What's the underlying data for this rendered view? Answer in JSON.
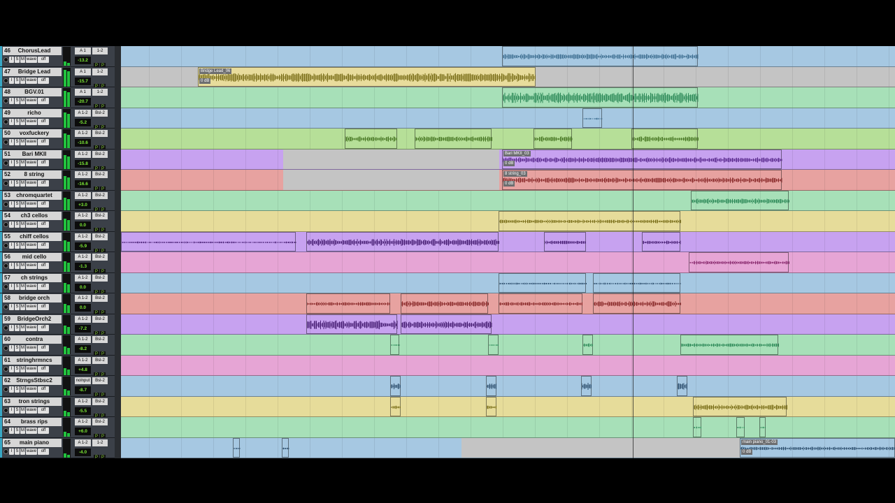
{
  "colors": {
    "blue": "#a6c8e2",
    "yellow": "#e6dc9a",
    "green": "#a7e0b8",
    "lime": "#b6df98",
    "purple": "#c7a2f0",
    "salmon": "#e7a2a0",
    "pink": "#e6a5d5",
    "gap": "#c4c4c4"
  },
  "tracks": [
    {
      "num": "46",
      "name": "ChorusLead",
      "io1": "A 1",
      "io2": "1-2",
      "vol": "-13.2",
      "color": "blue",
      "clips": [
        {
          "s": 545,
          "e": 825,
          "w": 3,
          "c": "#3f6f92"
        }
      ]
    },
    {
      "num": "47",
      "name": "Bridge Lead",
      "io1": "A 1",
      "io2": "1-2",
      "vol": "-15.7",
      "color": "gap",
      "clips": [
        {
          "s": 110,
          "e": 593,
          "w": 5,
          "c": "#7b6f1a",
          "bg": "#e8dc9c",
          "label": "Bridge Lead_06",
          "gain": "0 dB"
        }
      ]
    },
    {
      "num": "48",
      "name": "BGV.01",
      "io1": "A 1",
      "io2": "1-2",
      "vol": "-20.7",
      "color": "green",
      "clips": [
        {
          "s": 545,
          "e": 825,
          "w": 6,
          "c": "#2e8a59"
        }
      ]
    },
    {
      "num": "49",
      "name": "richo",
      "io1": "A 1-2",
      "io2": "Bsl-2",
      "vol": "-5.2",
      "color": "blue",
      "clips": [
        {
          "s": 660,
          "e": 688,
          "w": 1,
          "c": "#3f6f92"
        }
      ]
    },
    {
      "num": "50",
      "name": "voxfuckery",
      "io1": "A 1-2",
      "io2": "Bsl-2",
      "vol": "-10.6",
      "color": "lime",
      "clips": [
        {
          "s": 320,
          "e": 395,
          "w": 3,
          "c": "#4a7a26"
        },
        {
          "s": 420,
          "e": 530,
          "w": 3,
          "c": "#4a7a26"
        },
        {
          "s": 590,
          "e": 645,
          "w": 3,
          "c": "#4a7a26"
        },
        {
          "s": 730,
          "e": 825,
          "w": 3,
          "c": "#4a7a26"
        }
      ]
    },
    {
      "num": "51",
      "name": "Bari MKII",
      "io1": "A 1-2",
      "io2": "Bsl-2",
      "vol": "-15.8",
      "color": "purple",
      "gapS": 232,
      "gapE": 541,
      "clips": [
        {
          "s": 545,
          "e": 945,
          "w": 3,
          "c": "#5a2a8e",
          "label": "Bari MKII_03",
          "gain": "0 dB"
        }
      ]
    },
    {
      "num": "52",
      "name": "8 string",
      "io1": "A 1-2",
      "io2": "Bsl-2",
      "vol": "-16.6",
      "color": "salmon",
      "gapS": 232,
      "gapE": 541,
      "clips": [
        {
          "s": 545,
          "e": 945,
          "w": 3,
          "c": "#8a2a2a",
          "label": "8 string_03",
          "gain": "0 dB"
        }
      ]
    },
    {
      "num": "53",
      "name": "chromquartet",
      "io1": "A 1-2",
      "io2": "Bsl-2",
      "vol": "+3.0",
      "color": "green",
      "clips": [
        {
          "s": 815,
          "e": 955,
          "w": 3,
          "c": "#2e8a59"
        }
      ]
    },
    {
      "num": "54",
      "name": "ch3 cellos",
      "io1": "A 1-2",
      "io2": "Bsl-2",
      "vol": "0.0",
      "color": "yellow",
      "clips": [
        {
          "s": 540,
          "e": 800,
          "w": 2,
          "c": "#7b6f1a"
        }
      ]
    },
    {
      "num": "55",
      "name": "chiff cellos",
      "io1": "A 1-2",
      "io2": "Bsl-2",
      "vol": "-5.9",
      "color": "purple",
      "clips": [
        {
          "s": 0,
          "e": 250,
          "w": 1,
          "c": "#4a2076"
        },
        {
          "s": 265,
          "e": 540,
          "w": 4,
          "c": "#4a2076"
        },
        {
          "s": 605,
          "e": 665,
          "w": 2,
          "c": "#4a2076"
        },
        {
          "s": 745,
          "e": 800,
          "w": 2,
          "c": "#4a2076"
        }
      ]
    },
    {
      "num": "56",
      "name": "mid cello",
      "io1": "A 1-2",
      "io2": "Bsl-2",
      "vol": "-1.3",
      "color": "pink",
      "clips": [
        {
          "s": 812,
          "e": 955,
          "w": 2,
          "c": "#8a2a6e"
        }
      ]
    },
    {
      "num": "57",
      "name": "ch strings",
      "io1": "A 1-2",
      "io2": "Bsl-2",
      "vol": "0.0",
      "color": "blue",
      "clips": [
        {
          "s": 540,
          "e": 665,
          "w": 1,
          "c": "#2e4f6e"
        },
        {
          "s": 675,
          "e": 800,
          "w": 1,
          "c": "#2e4f6e"
        }
      ]
    },
    {
      "num": "58",
      "name": "bridge orch",
      "io1": "A 1-2",
      "io2": "Bsl-2",
      "vol": "0.0",
      "color": "salmon",
      "clips": [
        {
          "s": 265,
          "e": 385,
          "w": 2,
          "c": "#8a2a2a"
        },
        {
          "s": 400,
          "e": 525,
          "w": 3,
          "c": "#8a2a2a"
        },
        {
          "s": 540,
          "e": 660,
          "w": 2,
          "c": "#8a2a2a"
        },
        {
          "s": 675,
          "e": 800,
          "w": 3,
          "c": "#8a2a2a"
        }
      ]
    },
    {
      "num": "59",
      "name": "BridgeOrch2",
      "io1": "A 1-2",
      "io2": "Bsl-2",
      "vol": "-7.2",
      "color": "purple",
      "clips": [
        {
          "s": 265,
          "e": 395,
          "w": 5,
          "c": "#4a2076"
        },
        {
          "s": 400,
          "e": 530,
          "w": 4,
          "c": "#4a2076"
        }
      ]
    },
    {
      "num": "60",
      "name": "contra",
      "io1": "A 1-2",
      "io2": "Bsl-2",
      "vol": "-8.2",
      "color": "green",
      "clips": [
        {
          "s": 385,
          "e": 398,
          "w": 1,
          "c": "#2e8a59"
        },
        {
          "s": 525,
          "e": 540,
          "w": 1,
          "c": "#2e8a59"
        },
        {
          "s": 660,
          "e": 675,
          "w": 2,
          "c": "#2e8a59"
        },
        {
          "s": 800,
          "e": 940,
          "w": 2,
          "c": "#2e8a59"
        }
      ]
    },
    {
      "num": "61",
      "name": "stringhrmncs",
      "io1": "A 1-2",
      "io2": "Bsl-2",
      "vol": "+4.8",
      "color": "pink",
      "clips": []
    },
    {
      "num": "62",
      "name": "StrngsStbsc2",
      "io1": "nolnput",
      "io2": "Bsl-2",
      "vol": "-8.7",
      "color": "blue",
      "clips": [
        {
          "s": 385,
          "e": 400,
          "w": 4,
          "c": "#2e4f6e"
        },
        {
          "s": 522,
          "e": 537,
          "w": 4,
          "c": "#2e4f6e"
        },
        {
          "s": 658,
          "e": 673,
          "w": 4,
          "c": "#2e4f6e"
        },
        {
          "s": 795,
          "e": 810,
          "w": 4,
          "c": "#2e4f6e"
        }
      ]
    },
    {
      "num": "63",
      "name": "tron strings",
      "io1": "A 1-2",
      "io2": "Bsl-2",
      "vol": "-5.5",
      "color": "yellow",
      "clips": [
        {
          "s": 385,
          "e": 400,
          "w": 2,
          "c": "#7b6f1a"
        },
        {
          "s": 522,
          "e": 537,
          "w": 2,
          "c": "#7b6f1a"
        },
        {
          "s": 818,
          "e": 952,
          "w": 3,
          "c": "#7b6f1a"
        }
      ]
    },
    {
      "num": "64",
      "name": "brass rips",
      "io1": "A 1-2",
      "io2": "Bsl-2",
      "vol": "+6.0",
      "color": "green",
      "clips": [
        {
          "s": 818,
          "e": 830,
          "w": 1,
          "c": "#2e8a59"
        },
        {
          "s": 880,
          "e": 892,
          "w": 1,
          "c": "#2e8a59"
        },
        {
          "s": 913,
          "e": 922,
          "w": 1,
          "c": "#2e8a59"
        }
      ]
    },
    {
      "num": "65",
      "name": "main piano",
      "io1": "A 1-2",
      "io2": "1-2",
      "vol": "-4.0",
      "color": "blue",
      "gapS": 487,
      "gapE": 885,
      "clips": [
        {
          "s": 160,
          "e": 170,
          "w": 1,
          "c": "#2e4f6e"
        },
        {
          "s": 230,
          "e": 240,
          "w": 1,
          "c": "#2e4f6e"
        },
        {
          "s": 885,
          "e": 1107,
          "w": 2,
          "c": "#2e4f6e",
          "label": "main piano_01-03",
          "gain": "0 dB"
        }
      ]
    }
  ]
}
